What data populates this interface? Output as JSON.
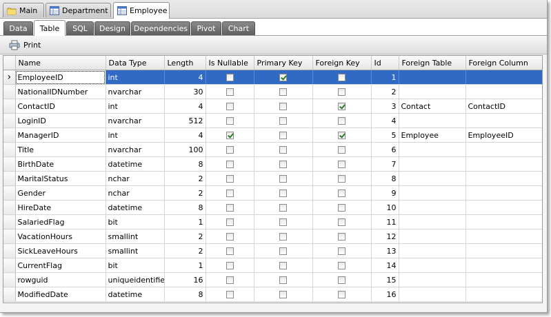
{
  "doc_tabs": [
    {
      "label": "Main",
      "icon": "folder-icon"
    },
    {
      "label": "Department",
      "icon": "table-icon"
    },
    {
      "label": "Employee",
      "icon": "table-icon",
      "active": true
    }
  ],
  "sub_tabs": [
    "Data",
    "Table",
    "SQL",
    "Design",
    "Dependencies",
    "Pivot",
    "Chart"
  ],
  "active_sub_tab": "Table",
  "toolbar": {
    "print_label": "Print"
  },
  "grid": {
    "columns": [
      "Name",
      "Data Type",
      "Length",
      "Is Nullable",
      "Primary Key",
      "Foreign Key",
      "Id",
      "Foreign Table",
      "Foreign Column"
    ],
    "selected_row": 0,
    "rows": [
      {
        "name": "EmployeeID",
        "type": "int",
        "length": "4",
        "nullable": false,
        "pk": true,
        "fk": false,
        "id": "1",
        "ftable": "",
        "fcolumn": ""
      },
      {
        "name": "NationalIDNumber",
        "type": "nvarchar",
        "length": "30",
        "nullable": false,
        "pk": false,
        "fk": false,
        "id": "2",
        "ftable": "",
        "fcolumn": ""
      },
      {
        "name": "ContactID",
        "type": "int",
        "length": "4",
        "nullable": false,
        "pk": false,
        "fk": true,
        "id": "3",
        "ftable": "Contact",
        "fcolumn": "ContactID"
      },
      {
        "name": "LoginID",
        "type": "nvarchar",
        "length": "512",
        "nullable": false,
        "pk": false,
        "fk": false,
        "id": "4",
        "ftable": "",
        "fcolumn": ""
      },
      {
        "name": "ManagerID",
        "type": "int",
        "length": "4",
        "nullable": true,
        "pk": false,
        "fk": true,
        "id": "5",
        "ftable": "Employee",
        "fcolumn": "EmployeeID"
      },
      {
        "name": "Title",
        "type": "nvarchar",
        "length": "100",
        "nullable": false,
        "pk": false,
        "fk": false,
        "id": "6",
        "ftable": "",
        "fcolumn": ""
      },
      {
        "name": "BirthDate",
        "type": "datetime",
        "length": "8",
        "nullable": false,
        "pk": false,
        "fk": false,
        "id": "7",
        "ftable": "",
        "fcolumn": ""
      },
      {
        "name": "MaritalStatus",
        "type": "nchar",
        "length": "2",
        "nullable": false,
        "pk": false,
        "fk": false,
        "id": "8",
        "ftable": "",
        "fcolumn": ""
      },
      {
        "name": "Gender",
        "type": "nchar",
        "length": "2",
        "nullable": false,
        "pk": false,
        "fk": false,
        "id": "9",
        "ftable": "",
        "fcolumn": ""
      },
      {
        "name": "HireDate",
        "type": "datetime",
        "length": "8",
        "nullable": false,
        "pk": false,
        "fk": false,
        "id": "10",
        "ftable": "",
        "fcolumn": ""
      },
      {
        "name": "SalariedFlag",
        "type": "bit",
        "length": "1",
        "nullable": false,
        "pk": false,
        "fk": false,
        "id": "11",
        "ftable": "",
        "fcolumn": ""
      },
      {
        "name": "VacationHours",
        "type": "smallint",
        "length": "2",
        "nullable": false,
        "pk": false,
        "fk": false,
        "id": "12",
        "ftable": "",
        "fcolumn": ""
      },
      {
        "name": "SickLeaveHours",
        "type": "smallint",
        "length": "2",
        "nullable": false,
        "pk": false,
        "fk": false,
        "id": "13",
        "ftable": "",
        "fcolumn": ""
      },
      {
        "name": "CurrentFlag",
        "type": "bit",
        "length": "1",
        "nullable": false,
        "pk": false,
        "fk": false,
        "id": "14",
        "ftable": "",
        "fcolumn": ""
      },
      {
        "name": "rowguid",
        "type": "uniqueidentifier",
        "length": "16",
        "nullable": false,
        "pk": false,
        "fk": false,
        "id": "15",
        "ftable": "",
        "fcolumn": ""
      },
      {
        "name": "ModifiedDate",
        "type": "datetime",
        "length": "8",
        "nullable": false,
        "pk": false,
        "fk": false,
        "id": "16",
        "ftable": "",
        "fcolumn": ""
      }
    ]
  }
}
